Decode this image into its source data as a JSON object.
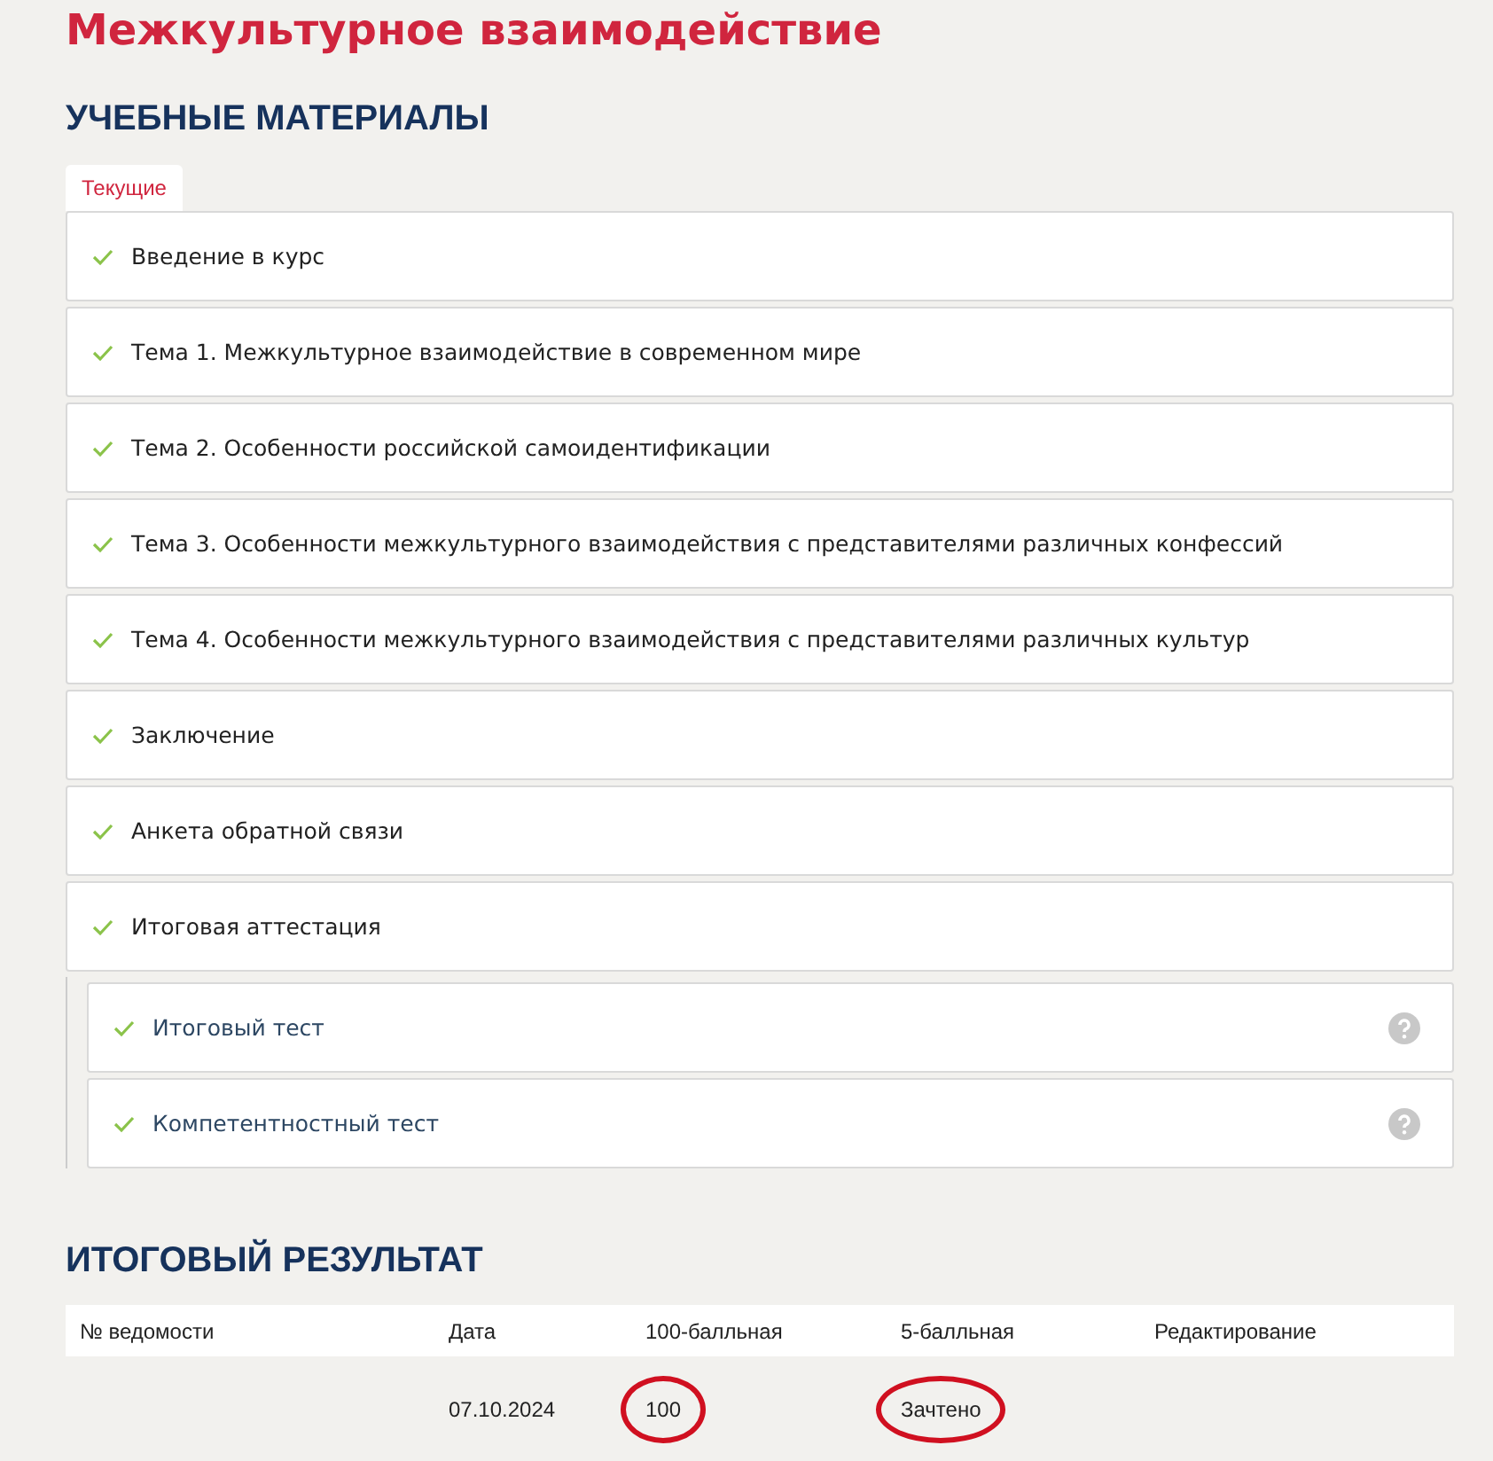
{
  "title": "Межкультурное взаимодействие",
  "materials": {
    "heading": "УЧЕБНЫЕ МАТЕРИАЛЫ",
    "tabs": [
      {
        "label": "Текущие",
        "selected": true
      }
    ],
    "items": [
      {
        "label": "Введение в курс",
        "checked": true
      },
      {
        "label": "Тема 1. Межкультурное взаимодействие в современном мире",
        "checked": true
      },
      {
        "label": "Тема 2. Особенности российской самоидентификации",
        "checked": true
      },
      {
        "label": "Тема 3. Особенности межкультурного взаимодействия с представителями различных конфессий",
        "checked": true
      },
      {
        "label": "Тема 4. Особенности межкультурного взаимодействия с представителями различных культур",
        "checked": true
      },
      {
        "label": "Заключение",
        "checked": true
      },
      {
        "label": "Анкета обратной связи",
        "checked": true
      },
      {
        "label": "Итоговая аттестация",
        "checked": true,
        "children": [
          {
            "label": "Итоговый тест",
            "checked": true
          },
          {
            "label": "Компетентностный тест",
            "checked": true
          }
        ]
      }
    ]
  },
  "result": {
    "heading": "ИТОГОВЫЙ РЕЗУЛЬТАТ",
    "columns": [
      "№ ведомости",
      "Дата",
      "100-балльная",
      "5-балльная",
      "Редактирование"
    ],
    "rows": [
      [
        {
          "circled": false
        },
        {
          "text": "07.10.2024",
          "circled": false
        },
        {
          "text": "100",
          "circled": true
        },
        {
          "text": "Зачтено",
          "circled": true
        },
        {
          "circled": false
        }
      ]
    ]
  }
}
